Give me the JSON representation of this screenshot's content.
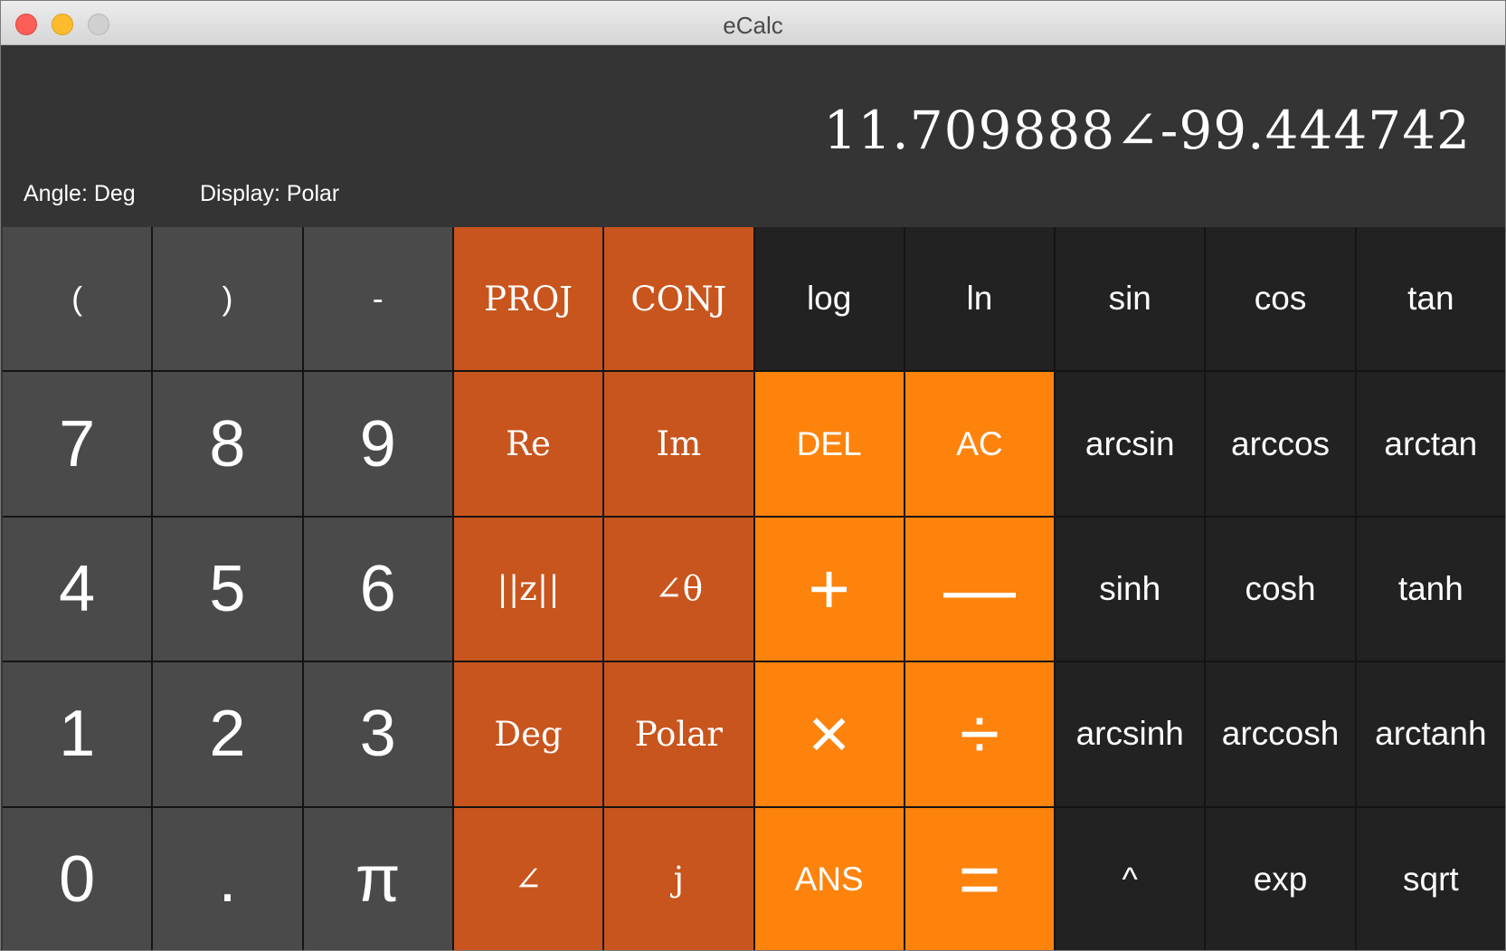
{
  "window": {
    "title": "eCalc"
  },
  "display": {
    "value": "11.709888∠-99.444742",
    "angle_mode": "Angle: Deg",
    "display_mode": "Display: Polar"
  },
  "keypad": {
    "keys": [
      {
        "label": "(",
        "name": "open-paren-button",
        "style": "paren"
      },
      {
        "label": ")",
        "name": "close-paren-button",
        "style": "paren"
      },
      {
        "label": "-",
        "name": "negate-button",
        "style": "paren"
      },
      {
        "label": "PROJ",
        "name": "proj-button",
        "style": "cplx"
      },
      {
        "label": "CONJ",
        "name": "conj-button",
        "style": "cplx"
      },
      {
        "label": "log",
        "name": "log-button",
        "style": "fn"
      },
      {
        "label": "ln",
        "name": "ln-button",
        "style": "fn"
      },
      {
        "label": "sin",
        "name": "sin-button",
        "style": "fn"
      },
      {
        "label": "cos",
        "name": "cos-button",
        "style": "fn"
      },
      {
        "label": "tan",
        "name": "tan-button",
        "style": "fn"
      },
      {
        "label": "7",
        "name": "digit-7-button",
        "style": "num"
      },
      {
        "label": "8",
        "name": "digit-8-button",
        "style": "num"
      },
      {
        "label": "9",
        "name": "digit-9-button",
        "style": "num"
      },
      {
        "label": "Re",
        "name": "re-button",
        "style": "cplx"
      },
      {
        "label": "Im",
        "name": "im-button",
        "style": "cplx"
      },
      {
        "label": "DEL",
        "name": "delete-button",
        "style": "op"
      },
      {
        "label": "AC",
        "name": "all-clear-button",
        "style": "op"
      },
      {
        "label": "arcsin",
        "name": "arcsin-button",
        "style": "fn"
      },
      {
        "label": "arccos",
        "name": "arccos-button",
        "style": "fn"
      },
      {
        "label": "arctan",
        "name": "arctan-button",
        "style": "fn"
      },
      {
        "label": "4",
        "name": "digit-4-button",
        "style": "num"
      },
      {
        "label": "5",
        "name": "digit-5-button",
        "style": "num"
      },
      {
        "label": "6",
        "name": "digit-6-button",
        "style": "num"
      },
      {
        "label": "||z||",
        "name": "magnitude-button",
        "style": "cplx"
      },
      {
        "label": "∠θ",
        "name": "angle-theta-button",
        "style": "cplx"
      },
      {
        "label": "+",
        "name": "plus-button",
        "style": "op-big"
      },
      {
        "label": "—",
        "name": "minus-button",
        "style": "op-big"
      },
      {
        "label": "sinh",
        "name": "sinh-button",
        "style": "fn"
      },
      {
        "label": "cosh",
        "name": "cosh-button",
        "style": "fn"
      },
      {
        "label": "tanh",
        "name": "tanh-button",
        "style": "fn"
      },
      {
        "label": "1",
        "name": "digit-1-button",
        "style": "num"
      },
      {
        "label": "2",
        "name": "digit-2-button",
        "style": "num"
      },
      {
        "label": "3",
        "name": "digit-3-button",
        "style": "num"
      },
      {
        "label": "Deg",
        "name": "deg-mode-button",
        "style": "cplx"
      },
      {
        "label": "Polar",
        "name": "polar-mode-button",
        "style": "cplx"
      },
      {
        "label": "×",
        "name": "multiply-button",
        "style": "op-big"
      },
      {
        "label": "÷",
        "name": "divide-button",
        "style": "op-big"
      },
      {
        "label": "arcsinh",
        "name": "arcsinh-button",
        "style": "fn"
      },
      {
        "label": "arccosh",
        "name": "arccosh-button",
        "style": "fn"
      },
      {
        "label": "arctanh",
        "name": "arctanh-button",
        "style": "fn"
      },
      {
        "label": "0",
        "name": "digit-0-button",
        "style": "num"
      },
      {
        "label": ".",
        "name": "decimal-point-button",
        "style": "num"
      },
      {
        "label": "π",
        "name": "pi-button",
        "style": "num"
      },
      {
        "label": "∠",
        "name": "angle-button",
        "style": "cplx"
      },
      {
        "label": "j",
        "name": "imaginary-j-button",
        "style": "cplx"
      },
      {
        "label": "ANS",
        "name": "answer-button",
        "style": "op"
      },
      {
        "label": "=",
        "name": "equals-button",
        "style": "op-big"
      },
      {
        "label": "^",
        "name": "power-button",
        "style": "fn"
      },
      {
        "label": "exp",
        "name": "exp-button",
        "style": "fn"
      },
      {
        "label": "sqrt",
        "name": "sqrt-button",
        "style": "fn"
      }
    ]
  },
  "colors": {
    "number_key": "#4a4a4a",
    "complex_key": "#c8551d",
    "operator_key": "#fd830d",
    "function_key": "#222222",
    "display_background": "#343434"
  }
}
